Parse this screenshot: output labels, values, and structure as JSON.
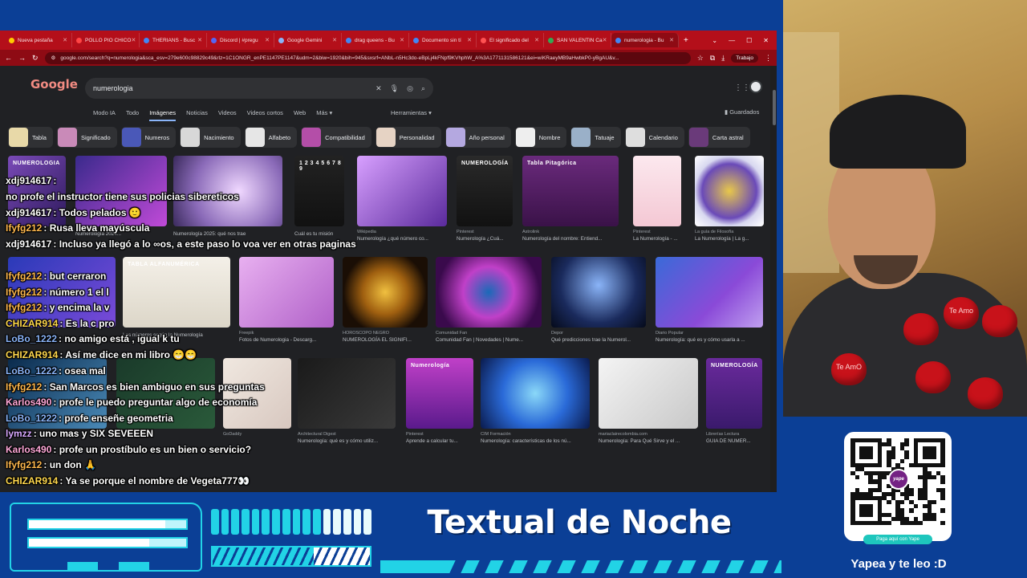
{
  "browser": {
    "tabs": [
      {
        "label": "Nueva pestaña",
        "color": "#ffcc00"
      },
      {
        "label": "POLLO PIO CHICO",
        "color": "#ff4444"
      },
      {
        "label": "THERIANS - Busc",
        "color": "#4285f4"
      },
      {
        "label": "Discord | #pregu",
        "color": "#5865f2"
      },
      {
        "label": "Google Gemini",
        "color": "#8ab4f8"
      },
      {
        "label": "drag queens - Bu",
        "color": "#4285f4"
      },
      {
        "label": "Documento sin tí",
        "color": "#4285f4"
      },
      {
        "label": "El significado del",
        "color": "#ff5252"
      },
      {
        "label": "SAN VALENTIN Ca",
        "color": "#34a853"
      },
      {
        "label": "numerologia - Bu",
        "color": "#4285f4"
      }
    ],
    "url": "google.com/search?q=numerologia&sca_esv=279e600c98829c49&rlz=1C1ONGR_enPE1147PE1147&udm=2&biw=1920&bih=945&sxsrf=ANbL-n5Hc3do-eBpLj4kFNpf9KVhphW_A%3A1771131586121&ei=wiKRaeyMB9aHwbkP0-yBgAU&v...",
    "profile": "Trabajo"
  },
  "google": {
    "logo": "Google",
    "query": "numerologia",
    "nav": [
      "Modo IA",
      "Todo",
      "Imágenes",
      "Noticias",
      "Videos",
      "Videos cortos",
      "Web",
      "Más ▾"
    ],
    "tools": "Herramientas ▾",
    "saved": "Guardados",
    "chips": [
      {
        "label": "Tabla",
        "color": "#e8d9a8"
      },
      {
        "label": "Significado",
        "color": "#c98ab8"
      },
      {
        "label": "Numeros",
        "color": "#4a58b8"
      },
      {
        "label": "Nacimiento",
        "color": "#d8d8d8"
      },
      {
        "label": "Alfabeto",
        "color": "#e6e6e6"
      },
      {
        "label": "Compatibilidad",
        "color": "#b44ea8"
      },
      {
        "label": "Personalidad",
        "color": "#e6d3c4"
      },
      {
        "label": "Año personal",
        "color": "#b4a8e0"
      },
      {
        "label": "Nombre",
        "color": "#eeeeee"
      },
      {
        "label": "Tatuaje",
        "color": "#9ab0c8"
      },
      {
        "label": "Calendario",
        "color": "#dedede"
      },
      {
        "label": "Carta astral",
        "color": "#6a3a7a"
      }
    ],
    "results": [
      {
        "title": "",
        "source": "",
        "bg": "linear-gradient(135deg,#7a4ab8,#2e1a5c)",
        "text": "NUMEROLOGIA"
      },
      {
        "title": "Numerología 2024...",
        "source": "",
        "bg": "linear-gradient(135deg,#3a2a8c,#c04ad8)",
        "text": ""
      },
      {
        "title": "Numerología 2025: qué nos trae",
        "source": "",
        "bg": "radial-gradient(circle at 60% 50%,#f0d8ff,#8a6ab8 60%,#3a2a5c)",
        "text": ""
      },
      {
        "title": "Cuál es tu misión",
        "source": "",
        "bg": "linear-gradient(180deg,#222,#111)",
        "text": "1 2 3 4 5 6 7 8 9"
      },
      {
        "title": "Numerología ¿qué número co...",
        "source": "Wikipedia",
        "bg": "linear-gradient(135deg,#d8a0ff,#5a2a9c)",
        "text": ""
      },
      {
        "title": "Numerología ¿Cuá...",
        "source": "Pinterest",
        "bg": "linear-gradient(180deg,#2a2a2a,#111)",
        "text": "NUMEROLOGÍA"
      },
      {
        "title": "Numerología del nombre: Entiend...",
        "source": "Astrolink",
        "bg": "linear-gradient(180deg,#6a2a7c,#3a1248)",
        "text": "Tabla Pitagórica"
      },
      {
        "title": "La Numerología - ...",
        "source": "Pinterest",
        "bg": "linear-gradient(180deg,#fce8ee,#f4c8d4)",
        "text": ""
      },
      {
        "title": "La Numerología | La g...",
        "source": "La guía de Filosofía",
        "bg": "radial-gradient(circle,#e8c84a,#6a4ab8 55%,#d8d8f0 70%,#fff)",
        "text": ""
      },
      {
        "title": "",
        "source": "",
        "bg": "linear-gradient(135deg,#2a3ab8,#7a4ad8)",
        "text": ""
      },
      {
        "title": "Los números según la Numerología",
        "source": "",
        "bg": "linear-gradient(180deg,#f4f0e8,#dcd6c8)",
        "text": "TABLA ALFANUMÉRICA"
      },
      {
        "title": "Fotos de Numerologia - Descarg...",
        "source": "Freepik",
        "bg": "linear-gradient(135deg,#e8b0f0,#b060c8)",
        "text": ""
      },
      {
        "title": "NUMEROLOGÍA EL SIGNIFI...",
        "source": "HORÓSCOPO NEGRO",
        "bg": "radial-gradient(circle,#f0c040,#a06010 40%,#1a0e05 75%)",
        "text": ""
      },
      {
        "title": "Comunidad Fan | Novedades | Nume...",
        "source": "Comunidad Fan",
        "bg": "radial-gradient(circle,#1a6ab8,#c040c8 40%,#3a0a4c 80%)",
        "text": ""
      },
      {
        "title": "Qué predicciones trae la Numerol...",
        "source": "Depor",
        "bg": "radial-gradient(circle at 50% 40%,#8ab4f8,#1a2a5c 60%,#050a1a)",
        "text": ""
      },
      {
        "title": "Numerología: qué es y cómo usarla a ...",
        "source": "Diario Popular",
        "bg": "linear-gradient(135deg,#3a6ad8,#8a4ad8 60%,#c0a0f0)",
        "text": ""
      },
      {
        "title": "",
        "source": "Lecturas",
        "bg": "linear-gradient(135deg,#0a2a4c,#4a8ab8)",
        "text": ""
      },
      {
        "title": "",
        "source": "Clarín.com",
        "bg": "linear-gradient(135deg,#1a3a2a,#2a5a3a)",
        "text": ""
      },
      {
        "title": "",
        "source": "GoDaddy",
        "bg": "linear-gradient(135deg,#f0e8e0,#d8c8c0)",
        "text": ""
      },
      {
        "title": "Numerología: qué es y cómo utiliz...",
        "source": "Architectural Digest",
        "bg": "linear-gradient(135deg,#1a1a1a,#3a3a3a)",
        "text": ""
      },
      {
        "title": "Aprende a calcular tu...",
        "source": "Pinterest",
        "bg": "linear-gradient(180deg,#c040c8,#5a1a8c)",
        "text": "Numerología"
      },
      {
        "title": "Numerología: características de los nú...",
        "source": "CIM Formación",
        "bg": "radial-gradient(circle,#8ad8f8,#2a6ad8 50%,#0a1a4c)",
        "text": ""
      },
      {
        "title": "Numerología: Para Qué Sirve y el ...",
        "source": "mariaclairecolombia.com",
        "bg": "linear-gradient(135deg,#f4f4f4,#c8c8c8)",
        "text": ""
      },
      {
        "title": "GUIA DE NUMER...",
        "source": "Librerías Lectura",
        "bg": "linear-gradient(180deg,#6a2a9c,#3a1a6c)",
        "text": "NUMEROLOGÍA"
      }
    ]
  },
  "chat": [
    {
      "user": "xdj914617",
      "msg": "",
      "color": "#ffffff"
    },
    {
      "user": "",
      "msg": "no profe el instructor tiene sus policias sibereticos",
      "color": "#ffffff"
    },
    {
      "user": "xdj914617",
      "msg": "Todos pelados 🙂",
      "color": "#ffffff"
    },
    {
      "user": "Ifyfg212",
      "msg": "Rusa lleva mayúscula",
      "color": "#ffb84d"
    },
    {
      "user": "xdj914617",
      "msg": "Incluso ya llegó a lo ∞os, a este paso lo voa ver en otras paginas",
      "color": "#ffffff"
    },
    {
      "user": "Ifyfg212",
      "msg": "but cerraron",
      "color": "#ffb84d"
    },
    {
      "user": "Ifyfg212",
      "msg": "número 1 el l",
      "color": "#ffb84d"
    },
    {
      "user": "Ifyfg212",
      "msg": "y encima la v",
      "color": "#ffb84d"
    },
    {
      "user": "CHIZAR914",
      "msg": "Es la c pro",
      "color": "#ffd84d"
    },
    {
      "user": "LoBo_1222",
      "msg": "no amigo está , igual k tu",
      "color": "#8ab4f8"
    },
    {
      "user": "CHIZAR914",
      "msg": "Así me dice en mi libro 😁😁",
      "color": "#ffd84d"
    },
    {
      "user": "LoBo_1222",
      "msg": "osea mal",
      "color": "#8ab4f8"
    },
    {
      "user": "Ifyfg212",
      "msg": "San Marcos es bien ambiguo en sus preguntas",
      "color": "#ffb84d"
    },
    {
      "user": "Karlos490",
      "msg": "profe le puedo preguntar algo de economía",
      "color": "#ffa8d8"
    },
    {
      "user": "LoBo_1222",
      "msg": "profe enseñe geometria",
      "color": "#8ab4f8"
    },
    {
      "user": "lymzz",
      "msg": "uno mas y SIX SEVEEEN",
      "color": "#d8a8ff"
    },
    {
      "user": "Karlos490",
      "msg": "profe un prostíbulo es un bien o servicio?",
      "color": "#ffa8d8"
    },
    {
      "user": "Ifyfg212",
      "msg": "un don 🙏",
      "color": "#ffb84d"
    },
    {
      "user": "CHIZAR914",
      "msg": "Ya se porque el nombre de Vegeta777👀",
      "color": "#ffd84d"
    }
  ],
  "webcam": {
    "hearts": [
      "",
      "Te Amo",
      "",
      "Te AmO",
      "",
      ""
    ]
  },
  "overlay": {
    "title": "Textual de Noche",
    "qr_caption": "Paga aquí con Yape",
    "yape_brand": "yape",
    "yape_text": "Yapea y te leo :D",
    "accent": "#22d3e6"
  }
}
